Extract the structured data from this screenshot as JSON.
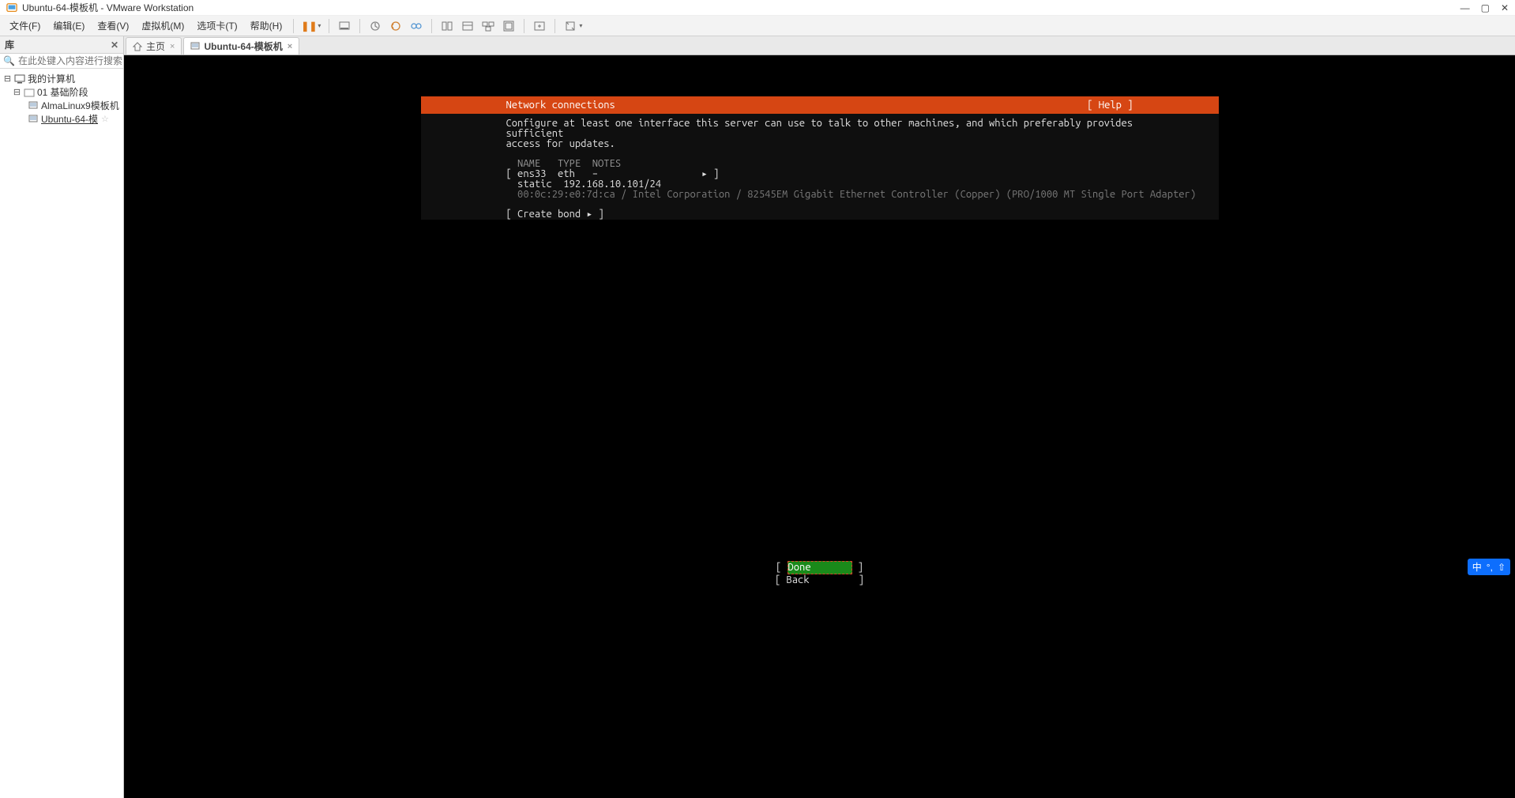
{
  "window": {
    "title": "Ubuntu-64-模板机 - VMware Workstation"
  },
  "menu": {
    "file": "文件(F)",
    "edit": "编辑(E)",
    "view": "查看(V)",
    "vm": "虚拟机(M)",
    "tabs": "选项卡(T)",
    "help": "帮助(H)"
  },
  "library": {
    "title": "库",
    "search_placeholder": "在此处键入内容进行搜索",
    "nodes": {
      "root": "我的计算机",
      "group1": "01 基础阶段",
      "vm1": "AlmaLinux9模板机",
      "vm2": "Ubuntu-64-模"
    }
  },
  "tabs": {
    "home": "主页",
    "active": "Ubuntu-64-模板机"
  },
  "installer": {
    "title": "Network connections",
    "help": "[ Help ]",
    "description": "Configure at least one interface this server can use to talk to other machines, and which preferably provides sufficient\naccess for updates.",
    "columns": "  NAME   TYPE  NOTES",
    "iface_row": "[ ens33  eth   –                  ▸ ]",
    "static_row": "  static  192.168.10.101/24",
    "hw_row": "  00:0c:29:e0:7d:ca / Intel Corporation / 82545EM Gigabit Ethernet Controller (Copper) (PRO/1000 MT Single Port Adapter)",
    "create_bond": "[ Create bond ▸ ]",
    "done": "Done",
    "back": "Back"
  },
  "ime": {
    "lang": "中",
    "punct": "°,",
    "caps": "⇧"
  }
}
